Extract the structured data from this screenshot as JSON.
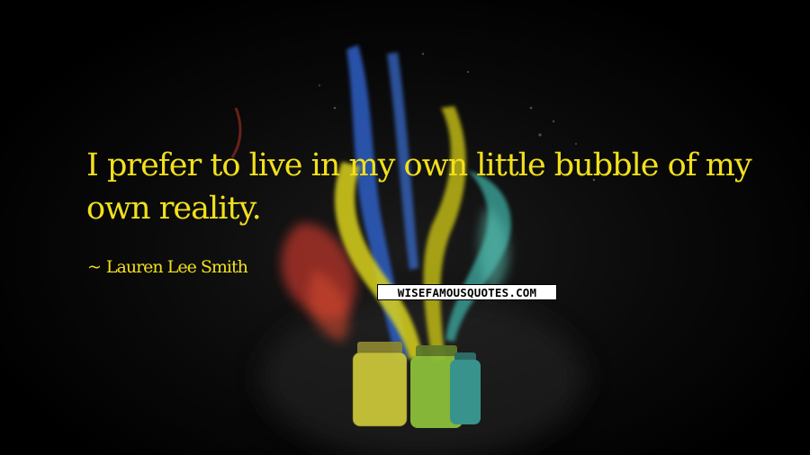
{
  "quote": {
    "text": "I prefer to live in my own little bubble of my own reality.",
    "author": "Lauren Lee Smith",
    "dash": "~",
    "text_color": "#f2e01c"
  },
  "watermark": {
    "text": "WISEFAMOUSQUOTES.COM"
  },
  "background": {
    "base_color": "#000000",
    "paint_colors": [
      "#d9d21c",
      "#2f5fc4",
      "#c43a2a",
      "#3aa39a",
      "#8bbf3a"
    ]
  }
}
